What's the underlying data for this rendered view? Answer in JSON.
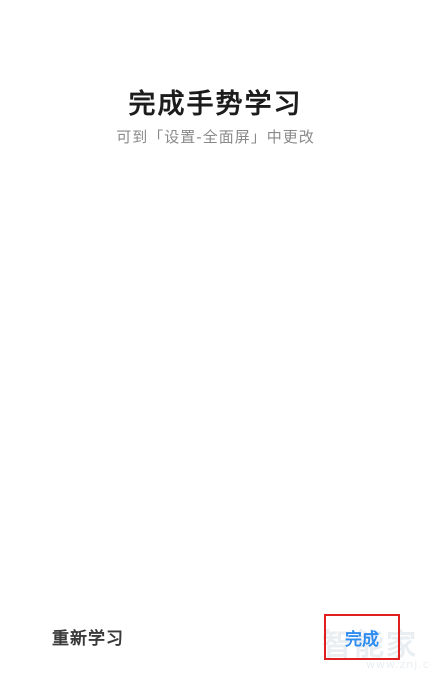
{
  "header": {
    "title": "完成手势学习",
    "subtitle": "可到「设置-全面屏」中更改"
  },
  "footer": {
    "relearn_label": "重新学习",
    "done_label": "完成"
  },
  "watermark": {
    "main": "智能家",
    "sub": "www.znj.com"
  },
  "colors": {
    "accent": "#2f8cf0",
    "highlight_box": "#e02020",
    "subtitle": "#8a8a8a"
  }
}
